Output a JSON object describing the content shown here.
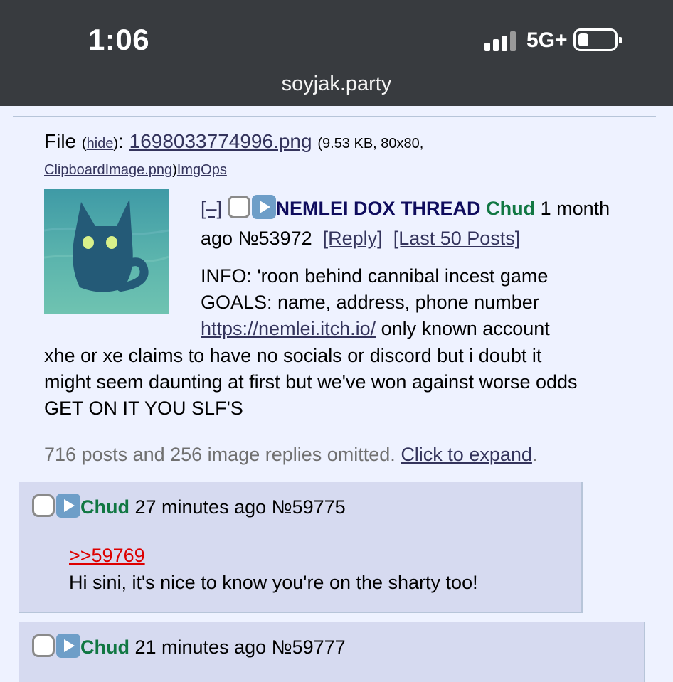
{
  "status_bar": {
    "time": "1:06",
    "network": "5G+"
  },
  "browser": {
    "url": "soyjak.party"
  },
  "op": {
    "file_label": "File",
    "hide_label": "hide",
    "file_name": "1698033774996.png",
    "file_meta": "(9.53 KB, 80x80,",
    "original_name": "ClipboardImage.png",
    "imgops_label": "ImgOps",
    "collapse_label": "[–]",
    "subject": "NEMLEI DOX THREAD",
    "name": "Chud",
    "time": "1 month ago",
    "post_no": "№53972",
    "reply_label": "[Reply]",
    "last50_label": "[Last 50 Posts]",
    "body_lines": [
      "INFO: 'roon behind cannibal incest game",
      "GOALS: name, address, phone number"
    ],
    "link_url": "https://nemlei.itch.io/",
    "link_suffix": " only known account",
    "body_lines_2": [
      "xhe or xe claims to have no socials or discord but i doubt it",
      "might seem daunting at first but we've won against worse odds",
      "GET ON IT YOU SLF'S"
    ]
  },
  "omitted": {
    "text": "716 posts and 256 image replies omitted. ",
    "expand_label": "Click to expand"
  },
  "replies": [
    {
      "name": "Chud",
      "time": "27 minutes ago",
      "post_no": "№59775",
      "quote": ">>59769",
      "body": "Hi sini, it's nice to know you're on the sharty too!"
    },
    {
      "name": "Chud",
      "time": "21 minutes ago",
      "post_no": "№59777"
    }
  ],
  "colors": {
    "page_bg": "#eef2ff",
    "reply_bg": "#d6daf0",
    "subject": "#0f0c5d",
    "name": "#117743",
    "quote": "#dd0000",
    "link": "#34345c",
    "topbar": "#383b3f"
  },
  "icons": [
    "signal-icon",
    "battery-icon",
    "checkbox-icon",
    "play-icon",
    "cat-thumbnail"
  ]
}
